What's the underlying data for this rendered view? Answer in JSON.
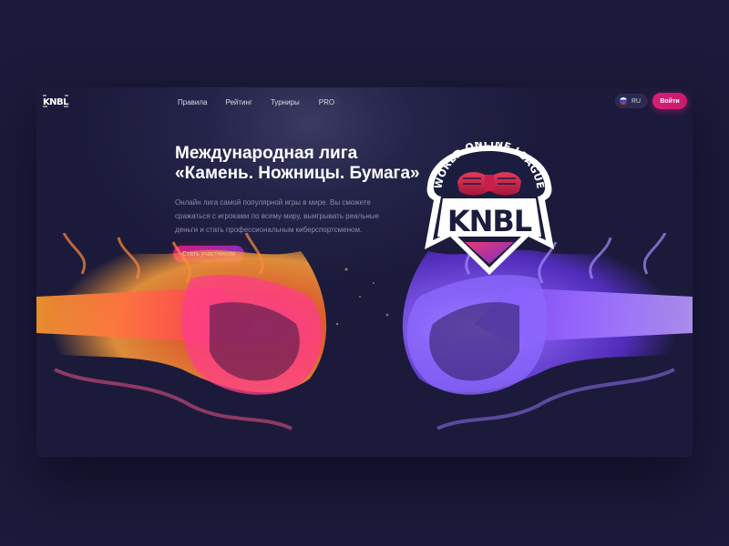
{
  "nav": {
    "logo": "KNBL",
    "items": [
      {
        "label": "Правила"
      },
      {
        "label": "Рейтинг"
      },
      {
        "label": "Турниры"
      },
      {
        "label": "PRO"
      }
    ],
    "language": "RU",
    "login_label": "Войти"
  },
  "hero": {
    "title_line1": "Международная лига",
    "title_line2": "«Камень. Ножницы. Бумага»",
    "desc_line1": "Онлайн лига самой популярной игры в мире. Вы сможете",
    "desc_line2": "сражаться с игроками по всему миру, выигрывать реальные",
    "desc_line3": "деньги и стать профессиональным киберспортсменом.",
    "cta_label": "Стать участником"
  },
  "emblem": {
    "arc_text": "WORLD ONLINE LEAGUE",
    "logo_text": "KNBL"
  },
  "colors": {
    "background": "#1b1a3a",
    "accent": "#d61e78",
    "accent_purple": "#8a2fb8",
    "fire_left": "#ff6a2a",
    "fire_right": "#8a5cff"
  },
  "icons": {
    "lang_flag": "russia-flag-icon",
    "left_fist": "flaming-fist-icon",
    "right_fist": "flaming-fist-icon"
  }
}
